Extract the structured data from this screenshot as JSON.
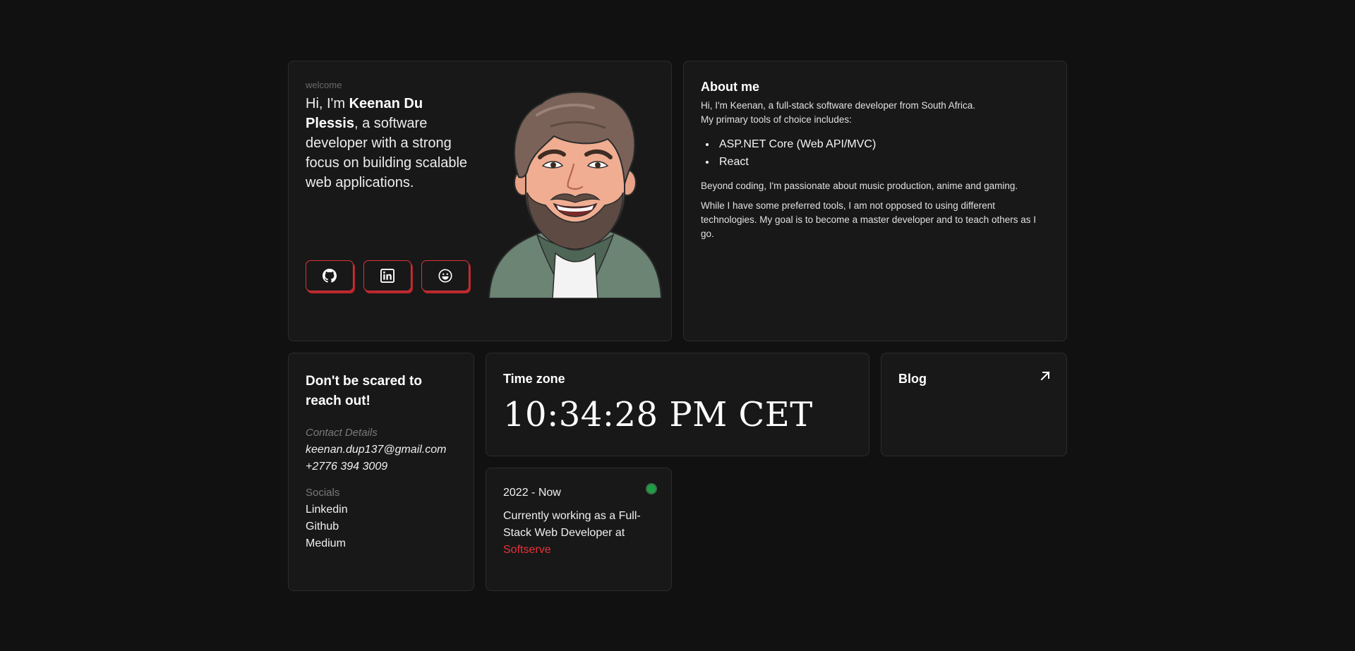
{
  "intro": {
    "welcome": "welcome",
    "greeting": "Hi, I'm",
    "name": "Keenan Du Plessis",
    "tagline": ", a software developer with a strong focus on building scalable web applications.",
    "socials": [
      {
        "name": "github-icon"
      },
      {
        "name": "linkedin-icon"
      },
      {
        "name": "medium-icon"
      }
    ],
    "accent": "#d9343a"
  },
  "about": {
    "title": "About me",
    "line1": "Hi, I'm Keenan, a full-stack software developer from South Africa.",
    "line2": "My primary tools of choice includes:",
    "tools": [
      "ASP.NET Core (Web API/MVC)",
      "React"
    ],
    "para1": "Beyond coding, I'm passionate about music production, anime and gaming.",
    "para2": "While I have some preferred tools, I am not opposed to using different technologies. My goal is to become a master developer and to teach others as I go."
  },
  "contact": {
    "title": "Don't be scared to reach out!",
    "details_label": "Contact Details",
    "email": "keenan.dup137@gmail.com",
    "phone": "+2776 394 3009",
    "socials_label": "Socials",
    "links": [
      "Linkedin",
      "Github",
      "Medium"
    ]
  },
  "timezone": {
    "title": "Time zone",
    "time": "10:34:28 PM CET"
  },
  "blog": {
    "title": "Blog",
    "icon": "arrow-up-right-icon"
  },
  "job": {
    "dates": "2022 - Now",
    "desc": "Currently working as a Full-Stack Web Developer at",
    "company": "Softserve",
    "status_color": "#1f9d45"
  }
}
